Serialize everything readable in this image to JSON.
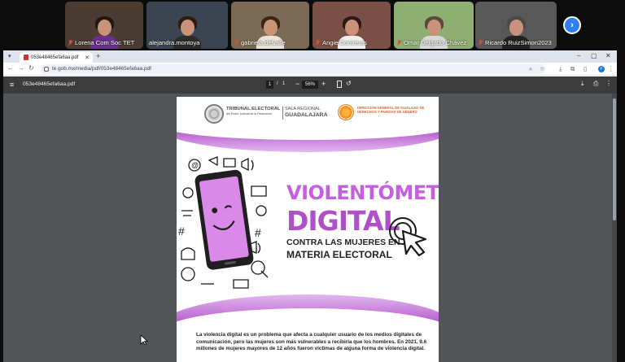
{
  "participants": [
    {
      "name": "Lorena Com Soc TET",
      "bg": "#4a3b33",
      "shirt": "#6a2f8f",
      "hair": "#1e1714",
      "active": false,
      "muted": true
    },
    {
      "name": "alejandra.montoya",
      "bg": "#3b4451",
      "shirt": "#2c2c2c",
      "hair": "#2b1c14",
      "active": true,
      "muted": false
    },
    {
      "name": "gabriela.delvalle",
      "bg": "#7b6a56",
      "shirt": "#e9e3da",
      "hair": "#3a2418",
      "active": false,
      "muted": true
    },
    {
      "name": "Angie Contreras",
      "bg": "#7a4f45",
      "shirt": "#f0f0f0",
      "hair": "#2a1a13",
      "active": false,
      "muted": true
    },
    {
      "name": "Omar Delgado Chávez",
      "bg": "#8fae72",
      "shirt": "#d9d9d9",
      "hair": "#5a4a3e",
      "active": false,
      "muted": true
    },
    {
      "name": "Ricardo RuizSimon2023",
      "bg": "#585858",
      "shirt": "#222222",
      "hair": "#4a4a4a",
      "active": false,
      "muted": true
    }
  ],
  "browser": {
    "tab_title": "053e48465efa6aa.pdf",
    "url": "te.gob.mx/media/pdf/053e48465efa6aa.pdf",
    "profile_initial": "F"
  },
  "pdf_viewer": {
    "doc_title": "053e48465efa6aa.pdf",
    "current_page": "1",
    "page_separator": "/",
    "total_pages": "1",
    "zoom": "56%"
  },
  "document": {
    "institution_line1": "TRIBUNAL ELECTORAL",
    "institution_line2": "del Poder Judicial de la Federación",
    "sala_line1": "SALA REGIONAL",
    "sala_line2": "GUADALAJARA",
    "dg_text": "DIRECCIÓN GENERAL DE IGUALDAD DE DERECHOS Y PARIDAD DE GÉNERO",
    "title_line1": "VIOLENTÓMETRO",
    "title_line2": "DIGITAL",
    "subtitle_line1": "CONTRA LAS MUJERES EN",
    "subtitle_line2": "MATERIA ELECTORAL",
    "body": "La violencia digital es un problema que afecta a cualquier usuario de los medios digitales de comunicación, pero las mujeres son más vulnerables a recibirla que los hombres. En 2021, 9.6 millones de mujeres mayores de 12 años fueron víctimas de alguna forma de violencia digital."
  },
  "colors": {
    "accent_purple": "#b04fc8",
    "light_purple": "#c65ee0",
    "dg_orange": "#d9622b",
    "active_speaker": "#3ec28f",
    "next_button": "#2f7ff0"
  },
  "icons": [
    "mic-off-icon",
    "chevron-right-icon",
    "menu-icon",
    "download-icon",
    "print-icon",
    "more-icon",
    "rotate-icon",
    "fit-page-icon",
    "phone-character-icon",
    "cursor-click-icon",
    "mouse-pointer-icon"
  ]
}
